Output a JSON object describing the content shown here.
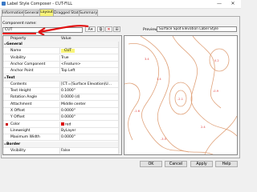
{
  "window": {
    "title": "Label Style Composer - CUT-FILL",
    "minimize_glyph": "—",
    "close_glyph": "✕"
  },
  "tabs": [
    {
      "label": "Information"
    },
    {
      "label": "General"
    },
    {
      "label": "Layout"
    },
    {
      "label": "Dragged State"
    },
    {
      "label": "Summary"
    }
  ],
  "component": {
    "label": "Component name:",
    "value": "CUT"
  },
  "toolbar_icons": [
    "add-component-icon",
    "dropdown-arrow-icon",
    "copy-component-icon",
    "delete-component-icon",
    "text-icon"
  ],
  "grid": {
    "headers": {
      "property": "Property",
      "value": "Value"
    },
    "rows": [
      {
        "type": "cat",
        "property": "General",
        "value": ""
      },
      {
        "type": "prop",
        "property": "Name",
        "value": "CUT",
        "highlight": true
      },
      {
        "type": "prop",
        "property": "Visibility",
        "value": "True"
      },
      {
        "type": "prop",
        "property": "Anchor Component",
        "value": "<Feature>"
      },
      {
        "type": "prop",
        "property": "Anchor Point",
        "value": "Top Left"
      },
      {
        "type": "cat",
        "property": "Text",
        "value": ""
      },
      {
        "type": "prop",
        "property": "Contents",
        "value": "[CT:=[Surface Elevation(U..."
      },
      {
        "type": "prop",
        "property": "Text Height",
        "value": "0.1000\""
      },
      {
        "type": "prop",
        "property": "Rotation Angle",
        "value": "0.0000 (d)"
      },
      {
        "type": "prop",
        "property": "Attachment",
        "value": "Middle center"
      },
      {
        "type": "prop",
        "property": "X Offset",
        "value": "0.0000\""
      },
      {
        "type": "prop",
        "property": "Y Offset",
        "value": "0.0000\""
      },
      {
        "type": "prop",
        "property": "Color",
        "value": "red",
        "swatch": true
      },
      {
        "type": "prop",
        "property": "Lineweight",
        "value": "ByLayer"
      },
      {
        "type": "prop",
        "property": "Maximum Width",
        "value": "0.0000\""
      },
      {
        "type": "cat",
        "property": "Border",
        "value": ""
      },
      {
        "type": "prop",
        "property": "Visibility",
        "value": "False"
      }
    ]
  },
  "preview": {
    "label": "Preview:",
    "select_value": "Surface Spot Elevation Label Style",
    "labels": [
      "3.4",
      "-2.1",
      "0.2",
      "-1.6",
      "2.4",
      "-3.5",
      "1.4",
      "-0.9"
    ]
  },
  "buttons": {
    "ok": "OK",
    "cancel": "Cancel",
    "apply": "Apply",
    "help": "Help"
  },
  "colors": {
    "highlight": "#f8f47a",
    "annotation_red": "#e11111",
    "contour": "#e0a27a"
  }
}
